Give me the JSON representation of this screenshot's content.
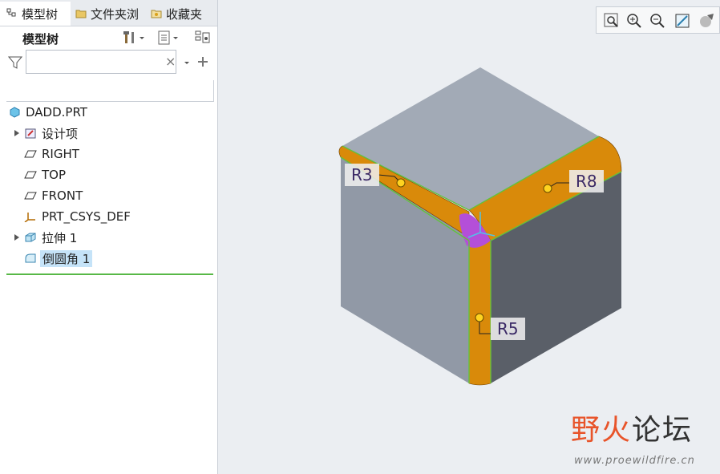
{
  "tabs": [
    {
      "label": "模型树",
      "icon": "model-tree-icon"
    },
    {
      "label": "文件夹浏",
      "icon": "folder-icon"
    },
    {
      "label": "收藏夹",
      "icon": "favorites-icon"
    }
  ],
  "panel": {
    "title": "模型树",
    "filter_value": "",
    "clear_glyph": "×"
  },
  "tree": [
    {
      "label": "DADD.PRT",
      "icon": "part-icon",
      "expandable": false
    },
    {
      "label": "设计项",
      "icon": "design-items-icon",
      "expandable": true
    },
    {
      "label": "RIGHT",
      "icon": "datum-plane-icon",
      "expandable": false
    },
    {
      "label": "TOP",
      "icon": "datum-plane-icon",
      "expandable": false
    },
    {
      "label": "FRONT",
      "icon": "datum-plane-icon",
      "expandable": false
    },
    {
      "label": "PRT_CSYS_DEF",
      "icon": "csys-icon",
      "expandable": false
    },
    {
      "label": "拉伸 1",
      "icon": "extrude-icon",
      "expandable": true
    },
    {
      "label": "倒圆角 1",
      "icon": "round-icon",
      "expandable": false,
      "selected": true
    }
  ],
  "view_toolbar": [
    "zoom-fit-icon",
    "zoom-in-icon",
    "zoom-out-icon",
    "repaint-icon",
    "display-style-icon"
  ],
  "dimensions": {
    "r3": "R3",
    "r8": "R8",
    "r5": "R5"
  },
  "watermark": {
    "title_a": "野火",
    "title_b": "论坛",
    "url": "www.proewildfire.cn"
  },
  "colors": {
    "fillet": "#d98a0a",
    "selection": "#c5e3f8",
    "highlight_edge": "#63c23c",
    "corner_patch": "#b44fd8"
  }
}
